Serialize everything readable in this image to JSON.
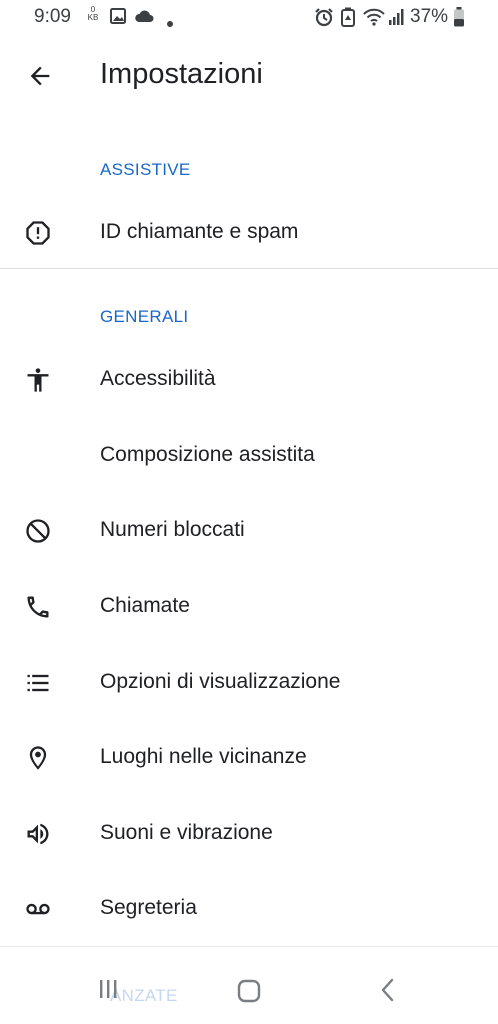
{
  "status_bar": {
    "time": "9:09",
    "data_speed_value": "0",
    "data_speed_unit": "KB",
    "battery_percent": "37%",
    "icons": [
      "image-icon",
      "cloud-icon",
      "dot-icon",
      "alarm-icon",
      "battery-saver-icon",
      "wifi-icon",
      "signal-icon",
      "battery-icon"
    ]
  },
  "app_bar": {
    "title": "Impostazioni",
    "back_icon": "arrow-back-icon"
  },
  "sections": {
    "assistive": {
      "header": "ASSISTIVE",
      "items": [
        {
          "label": "ID chiamante e spam",
          "icon": "alert-circle-icon"
        }
      ]
    },
    "general": {
      "header": "GENERALI",
      "items": [
        {
          "label": "Accessibilità",
          "icon": "accessibility-icon"
        },
        {
          "label": "Composizione assistita",
          "icon": ""
        },
        {
          "label": "Numeri bloccati",
          "icon": "block-icon"
        },
        {
          "label": "Chiamate",
          "icon": "phone-icon"
        },
        {
          "label": "Opzioni di visualizzazione",
          "icon": "list-icon"
        },
        {
          "label": "Luoghi nelle vicinanze",
          "icon": "location-pin-icon"
        },
        {
          "label": "Suoni e vibrazione",
          "icon": "volume-icon"
        },
        {
          "label": "Segreteria",
          "icon": "voicemail-icon"
        }
      ]
    }
  },
  "nav_bar": {
    "faded_text": "ANZATE",
    "buttons": [
      "recents-icon",
      "home-icon",
      "nav-back-icon"
    ]
  },
  "colors": {
    "accent": "#1a66c9",
    "text_primary": "#202124",
    "divider": "#dadce0"
  }
}
